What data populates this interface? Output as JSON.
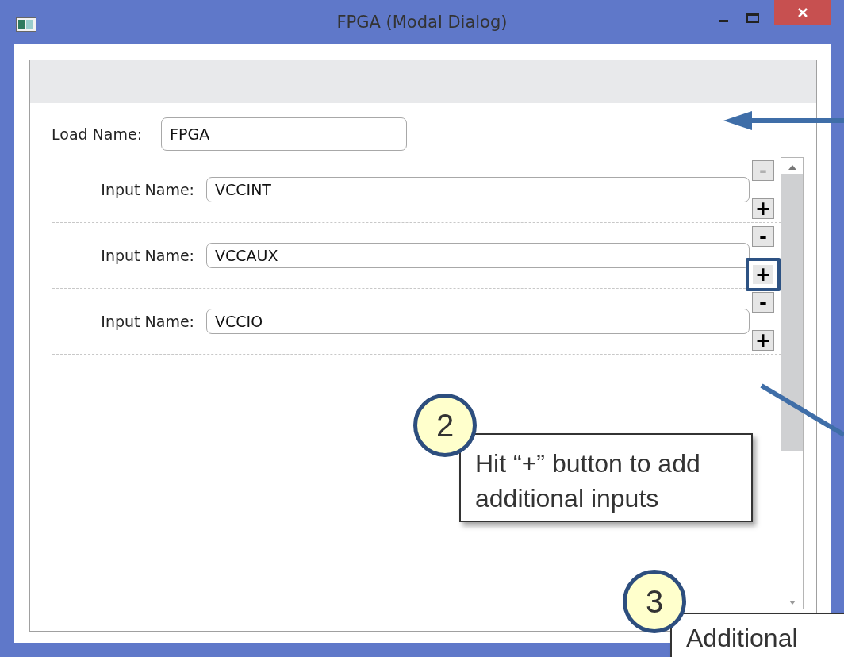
{
  "window": {
    "title": "FPGA (Modal Dialog)"
  },
  "load_name": {
    "label": "Load Name:",
    "value": "FPGA"
  },
  "inputs": [
    {
      "label": "Input Name:",
      "value": "VCCINT",
      "remove_disabled": true,
      "add_highlighted": false
    },
    {
      "label": "Input Name:",
      "value": "VCCAUX",
      "remove_disabled": false,
      "add_highlighted": true
    },
    {
      "label": "Input Name:",
      "value": "VCCIO",
      "remove_disabled": false,
      "add_highlighted": false
    }
  ],
  "buttons": {
    "add": "+",
    "remove": "-"
  },
  "callouts": [
    {
      "number": "2",
      "text": "Hit “+” button to add additional inputs"
    },
    {
      "number": "3",
      "text": "Additional"
    }
  ]
}
